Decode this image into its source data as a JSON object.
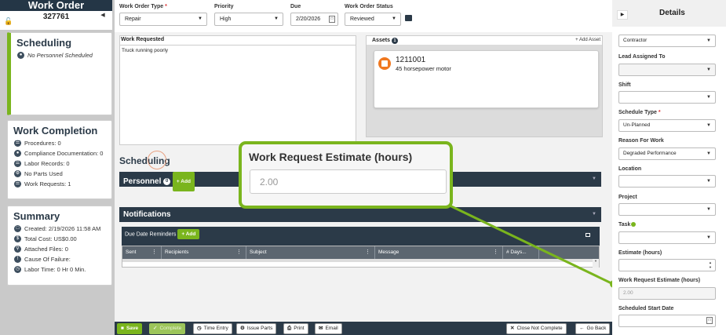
{
  "left": {
    "title": "Work Order",
    "number": "327761",
    "scheduling": {
      "title": "Scheduling",
      "personnel": "No Personnel Scheduled"
    },
    "completion": {
      "title": "Work Completion",
      "items": [
        "Procedures: 0",
        "Compliance Documentation: 0",
        "Labor Records: 0",
        "No Parts Used",
        "Work Requests: 1"
      ]
    },
    "summary": {
      "title": "Summary",
      "items": [
        "Created: 2/19/2026 11:58 AM",
        "Total Cost: US$0.00",
        "Attached Files: 0",
        "Cause Of Failure:",
        "Labor Time: 0 Hr 0 Min."
      ]
    }
  },
  "header": {
    "type_label": "Work Order Type",
    "type_req": "*",
    "type_value": "Repair",
    "priority_label": "Priority",
    "priority_value": "High",
    "due_label": "Due",
    "due_value": "2/20/2026",
    "status_label": "Work Order Status",
    "status_value": "Reviewed"
  },
  "work_requested": {
    "label": "Work Requested",
    "value": "Truck running poorly"
  },
  "assets": {
    "label": "Assets",
    "count": "1",
    "add_label": "+ Add Asset",
    "items": [
      {
        "id": "1211001",
        "desc": "45 horsepower motor"
      }
    ]
  },
  "scheduling_section": {
    "title": "Scheduling",
    "personnel_label": "Personnel",
    "personnel_count": "0",
    "add_label": "+ Add",
    "notifications_label": "Notifications",
    "due_reminders_label": "Due Date Reminders",
    "grid_columns": [
      "Sent",
      "Recipients",
      "Subject",
      "Message",
      "# Days..."
    ]
  },
  "callout": {
    "label": "Work Request Estimate (hours)",
    "value": "2.00"
  },
  "toolbar": {
    "save": "Save",
    "complete": "Complete",
    "time_entry": "Time Entry",
    "issue_parts": "Issue Parts",
    "print": "Print",
    "email": "Email",
    "close_not_complete": "Close Not Complete",
    "go_back": "Go Back"
  },
  "details": {
    "title": "Details",
    "fields": {
      "shift_group_label": "Shift",
      "contractor": "Contractor",
      "lead_label": "Lead Assigned To",
      "shift_label": "Shift",
      "schedule_type_label": "Schedule Type",
      "schedule_type_req": "*",
      "schedule_type_value": "Un-Planned",
      "reason_label": "Reason For Work",
      "reason_value": "Degraded Performance",
      "location_label": "Location",
      "project_label": "Project",
      "task_label": "Task",
      "estimate_label": "Estimate (hours)",
      "wre_label": "Work Request Estimate (hours)",
      "wre_value": "2.00",
      "start_label": "Scheduled Start Date"
    }
  },
  "colors": {
    "accent_green": "#7ab51d",
    "navy": "#2b3a48",
    "asset_orange": "#f07820"
  }
}
